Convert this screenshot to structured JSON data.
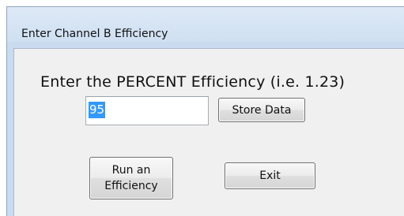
{
  "window": {
    "title": "Enter Channel B Efficiency"
  },
  "form": {
    "prompt": "Enter the PERCENT Efficiency (i.e. 1.23)",
    "efficiency_value": "95",
    "store_label": "Store Data",
    "run_label": "Run an\nEfficiency",
    "exit_label": "Exit"
  },
  "colors": {
    "title_bar": "#cfe0f2",
    "client_background": "#f0f0f0",
    "selection_highlight": "#3399ff"
  }
}
